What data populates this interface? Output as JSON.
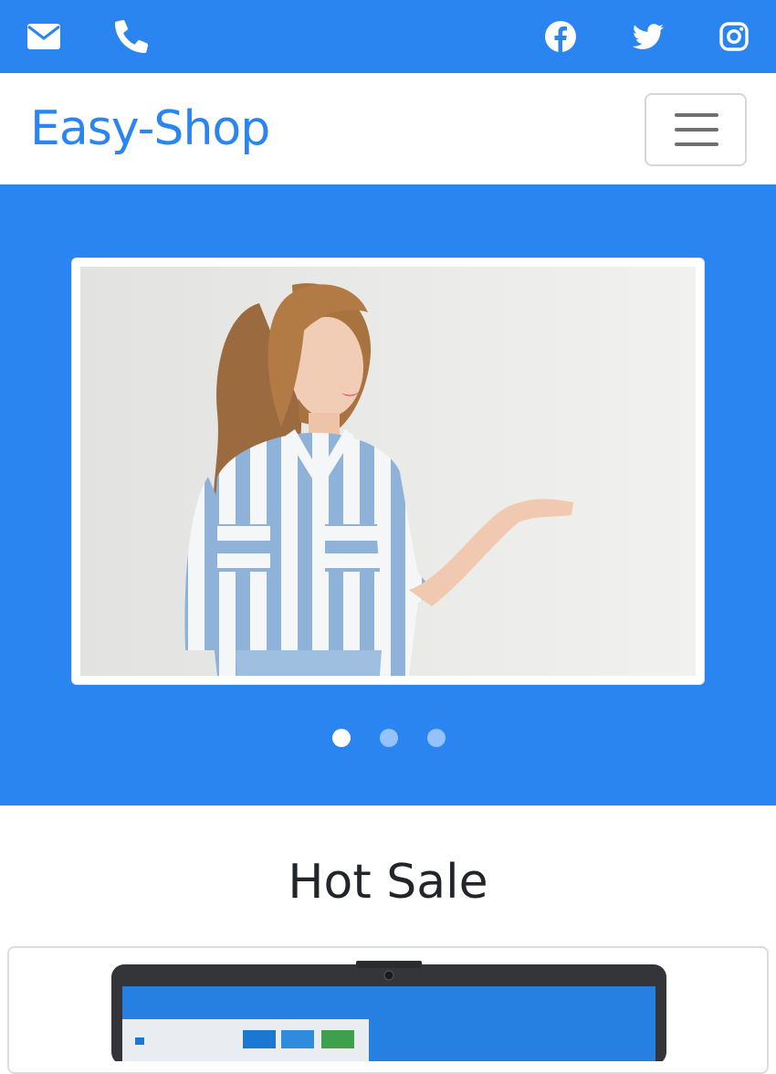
{
  "topbar": {
    "left_icons": [
      "envelope-icon",
      "phone-icon"
    ],
    "right_icons": [
      "facebook-icon",
      "twitter-icon",
      "instagram-icon"
    ],
    "color": "#2a85f0"
  },
  "navbar": {
    "brand": "Easy-Shop",
    "toggler_icon": "hamburger-menu-icon"
  },
  "carousel": {
    "slide_count": 3,
    "active_index": 0,
    "background": "#2a85f0"
  },
  "hot_sale": {
    "title": "Hot Sale"
  },
  "colors": {
    "accent": "#2a85f0",
    "text_dark": "#22252a"
  }
}
